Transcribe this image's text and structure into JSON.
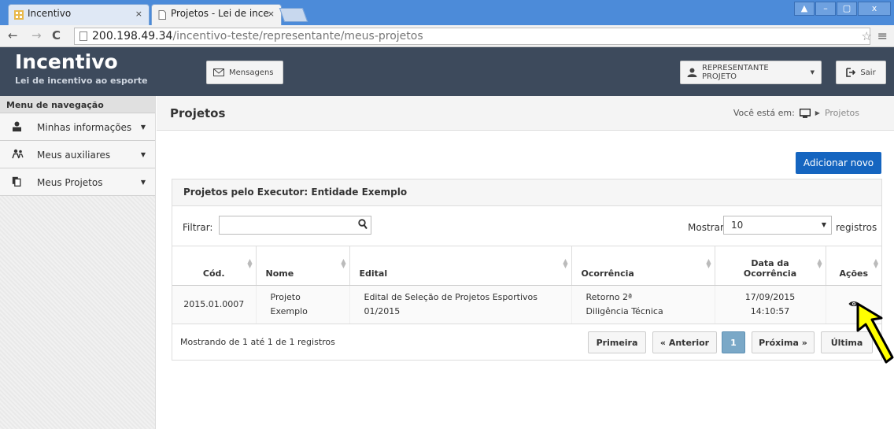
{
  "browser": {
    "tabs": [
      {
        "title": "Incentivo",
        "close": "×"
      },
      {
        "title": "Projetos - Lei de ince",
        "close": "×"
      }
    ],
    "window_controls": [
      "▲",
      "–",
      "▢",
      "x"
    ],
    "url_host": "200.198.49.34",
    "url_path": "/incentivo-teste/representante/meus-projetos"
  },
  "header": {
    "title": "Incentivo",
    "subtitle": "Lei de incentivo ao esporte",
    "messages_label": "Mensagens",
    "role_label": "REPRESENTANTE PROJETO",
    "logout_label": "Sair"
  },
  "sidebar": {
    "title": "Menu de navegação",
    "items": [
      {
        "label": "Minhas informações",
        "icon": "user-icon"
      },
      {
        "label": "Meus auxiliares",
        "icon": "users-icon"
      },
      {
        "label": "Meus Projetos",
        "icon": "copy-icon"
      }
    ]
  },
  "content": {
    "page_title": "Projetos",
    "breadcrumb_prefix": "Você está em:",
    "breadcrumb_current": "Projetos",
    "add_label": "Adicionar novo"
  },
  "panel": {
    "title": "Projetos pelo Executor: Entidade Exemplo",
    "filter_label": "Filtrar:",
    "filter_value": "",
    "show_label": "Mostrar",
    "show_value": "10",
    "records_label": "registros",
    "columns": [
      "Cód.",
      "Nome",
      "Edital",
      "Ocorrência",
      "Data da Ocorrência",
      "Ações"
    ],
    "rows": [
      {
        "cod": "2015.01.0007",
        "nome": "Projeto Exemplo",
        "edital": "Edital de Seleção de Projetos Esportivos 01/2015",
        "ocorrencia": "Retorno 2ª Diligência Técnica",
        "data": "17/09/2015 14:10:57"
      }
    ],
    "info": "Mostrando de 1 até 1 de 1 registros",
    "pagination": {
      "first": "Primeira",
      "prev": "« Anterior",
      "current": "1",
      "next": "Próxima »",
      "last": "Última"
    }
  },
  "colors": {
    "header_bg": "#3d4a5c",
    "primary": "#1565c0",
    "tabbar": "#4c8bd9",
    "arrow": "#ffff00"
  }
}
